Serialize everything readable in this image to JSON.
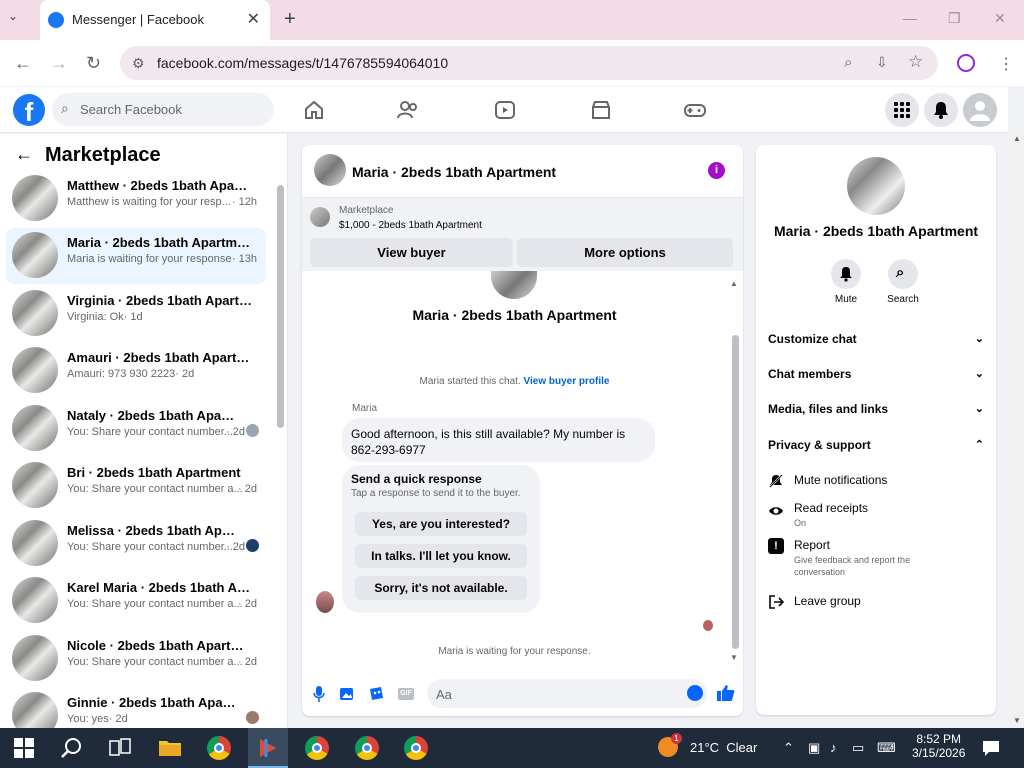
{
  "browser": {
    "tab_title": "Messenger | Facebook",
    "url": "facebook.com/messages/t/1476785594064010"
  },
  "fb": {
    "search_placeholder": "Search Facebook"
  },
  "left": {
    "title": "Marketplace",
    "conversations": [
      {
        "name": "Matthew · 2beds 1bath Apartm...",
        "preview": "Matthew is waiting for your resp...",
        "time": "· 12h"
      },
      {
        "name": "Maria · 2beds 1bath Apartment",
        "preview": "Maria is waiting for your response.",
        "time": "· 13h"
      },
      {
        "name": "Virginia · 2beds 1bath Apartment",
        "preview": "Virginia: Ok",
        "time": "· 1d"
      },
      {
        "name": "Amauri · 2beds 1bath Apartment",
        "preview": "Amauri: 973 930 2223",
        "time": "· 2d"
      },
      {
        "name": "Nataly · 2beds 1bath Apartm...",
        "preview": "You: Share your contact number...",
        "time": "· 2d"
      },
      {
        "name": "Bri · 2beds 1bath Apartment",
        "preview": "You: Share your contact number a...",
        "time": "· 2d"
      },
      {
        "name": "Melissa · 2beds 1bath Apartm...",
        "preview": "You: Share your contact number...",
        "time": "· 2d"
      },
      {
        "name": "Karel Maria · 2beds 1bath Apart...",
        "preview": "You: Share your contact number a...",
        "time": "· 2d"
      },
      {
        "name": "Nicole · 2beds 1bath Apartment",
        "preview": "You: Share your contact number a...",
        "time": "· 2d"
      },
      {
        "name": "Ginnie · 2beds 1bath Apartme...",
        "preview": "You: yes",
        "time": "· 2d"
      }
    ]
  },
  "chat": {
    "title": "Maria · 2beds 1bath Apartment",
    "marketplace_label": "Marketplace",
    "listing": "$1,000 - 2beds 1bath Apartment",
    "view_buyer": "View buyer",
    "more_options": "More options",
    "profile_name": "Maria · 2beds 1bath Apartment",
    "started": "Maria started this chat.",
    "view_profile": "View buyer profile",
    "sender": "Maria",
    "message": "Good afternoon, is this still available? My number is 862-293-6977",
    "quick_title": "Send a quick response",
    "quick_sub": "Tap a response to send it to the buyer.",
    "quick_options": [
      "Yes, are you interested?",
      "In talks. I'll let you know.",
      "Sorry, it's not available."
    ],
    "waiting": "Maria is waiting for your response.",
    "input_placeholder": "Aa"
  },
  "right": {
    "name": "Maria · 2beds 1bath Apartment",
    "mute": "Mute",
    "search": "Search",
    "sections": [
      "Customize chat",
      "Chat members",
      "Media, files and links",
      "Privacy & support"
    ],
    "mute_notifications": "Mute notifications",
    "read_receipts": "Read receipts",
    "read_receipts_state": "On",
    "report": "Report",
    "report_sub": "Give feedback and report the conversation",
    "leave_group": "Leave group"
  },
  "taskbar": {
    "weather": "21°C  Clear",
    "weather_badge": "1",
    "time": "8:52 PM",
    "date": "3/15/2026"
  },
  "colors": {
    "brand": "#1877f2",
    "accent": "#0866ff",
    "info": "#a50dcc"
  }
}
